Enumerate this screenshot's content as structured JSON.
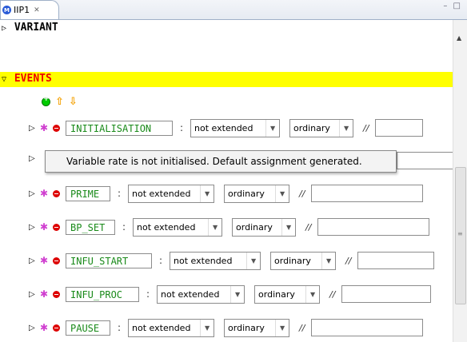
{
  "tab": {
    "title": "IIP1",
    "close": "✕",
    "icon": "M"
  },
  "window_controls": "– □",
  "sections": {
    "variant": "VARIANT",
    "events": "EVENTS"
  },
  "tooltip": "Variable rate is not initialised. Default assignment generated.",
  "comment_sep": "//",
  "colon": ":",
  "events": [
    {
      "name": "INITIALISATION",
      "extended": "not extended",
      "convergence": "ordinary",
      "warning": true
    },
    {
      "name": "PRIME",
      "extended": "not extended",
      "convergence": "ordinary",
      "warning": false
    },
    {
      "name": "BP_SET",
      "extended": "not extended",
      "convergence": "ordinary",
      "warning": false
    },
    {
      "name": "INFU_START",
      "extended": "not extended",
      "convergence": "ordinary",
      "warning": false
    },
    {
      "name": "INFU_PROC",
      "extended": "not extended",
      "convergence": "ordinary",
      "warning": false
    },
    {
      "name": "PAUSE",
      "extended": "not extended",
      "convergence": "ordinary",
      "warning": false
    }
  ],
  "colors": {
    "events_bg": "#ffff00",
    "events_text": "#ee0000",
    "event_name": "#1a8a1a"
  }
}
